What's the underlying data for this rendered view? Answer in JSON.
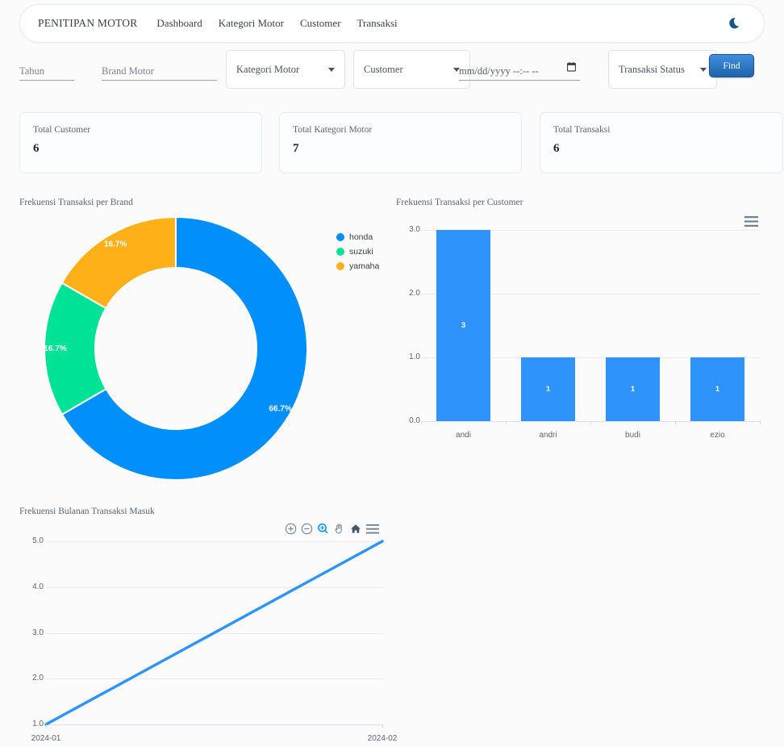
{
  "navbar": {
    "brand": "PENITIPAN MOTOR",
    "links": [
      {
        "label": "Dashboard"
      },
      {
        "label": "Kategori Motor"
      },
      {
        "label": "Customer"
      },
      {
        "label": "Transaksi"
      }
    ],
    "theme_toggle_icon": "moon-icon",
    "accent": "#1b5490"
  },
  "filters": {
    "tahun": {
      "placeholder": "Tahun",
      "value": ""
    },
    "brand": {
      "placeholder": "Brand Motor",
      "value": ""
    },
    "kategori": {
      "label": "Kategori Motor"
    },
    "customer": {
      "label": "Customer"
    },
    "tanggal": {
      "placeholder": "mm/dd/yyyy --:-- --",
      "value": "mm/dd/yyyy --:-- --"
    },
    "status": {
      "label": "Transaksi Status"
    },
    "find_label": "Find"
  },
  "cards": [
    {
      "label": "Total Customer",
      "value": "6"
    },
    {
      "label": "Total Kategori Motor",
      "value": "7"
    },
    {
      "label": "Total Transaksi",
      "value": "6"
    }
  ],
  "charts": {
    "donut_title": "Frekuensi Transaksi per Brand",
    "bar_title": "Frekuensi Transaksi per Customer",
    "line_title": "Frekuensi Bulanan Transaksi Masuk"
  },
  "chart_data": [
    {
      "type": "pie",
      "variant": "donut",
      "title": "Frekuensi Transaksi per Brand",
      "labels": [
        "honda",
        "suzuki",
        "yamaha"
      ],
      "values": [
        66.7,
        16.7,
        16.7
      ],
      "data_labels": [
        "66.7%",
        "16.7%",
        "16.7%"
      ],
      "colors": [
        "#008ffb",
        "#00e396",
        "#feb019"
      ],
      "legend": {
        "position": "right",
        "entries": [
          "honda",
          "suzuki",
          "yamaha"
        ]
      }
    },
    {
      "type": "bar",
      "title": "Frekuensi Transaksi per Customer",
      "categories": [
        "andi",
        "andri",
        "budi",
        "ezio"
      ],
      "values": [
        3,
        1,
        1,
        1
      ],
      "data_labels": [
        "3",
        "1",
        "1",
        "1"
      ],
      "ytick_labels": [
        "0.0",
        "1.0",
        "2.0",
        "3.0"
      ],
      "ylim": [
        0,
        3
      ],
      "color": "#2e93fa",
      "grid": true,
      "xlabel": "",
      "ylabel": ""
    },
    {
      "type": "line",
      "title": "Frekuensi Bulanan Transaksi Masuk",
      "x": [
        "2024-01",
        "2024-02"
      ],
      "values": [
        1,
        5
      ],
      "ytick_labels": [
        "1.0",
        "2.0",
        "3.0",
        "4.0",
        "5.0"
      ],
      "ylim": [
        1,
        5
      ],
      "color": "#2e93fa",
      "grid": true,
      "toolbar": [
        "zoom-in-icon",
        "zoom-out-icon",
        "selection-zoom-icon",
        "pan-icon",
        "reset-icon",
        "menu-icon"
      ]
    }
  ]
}
